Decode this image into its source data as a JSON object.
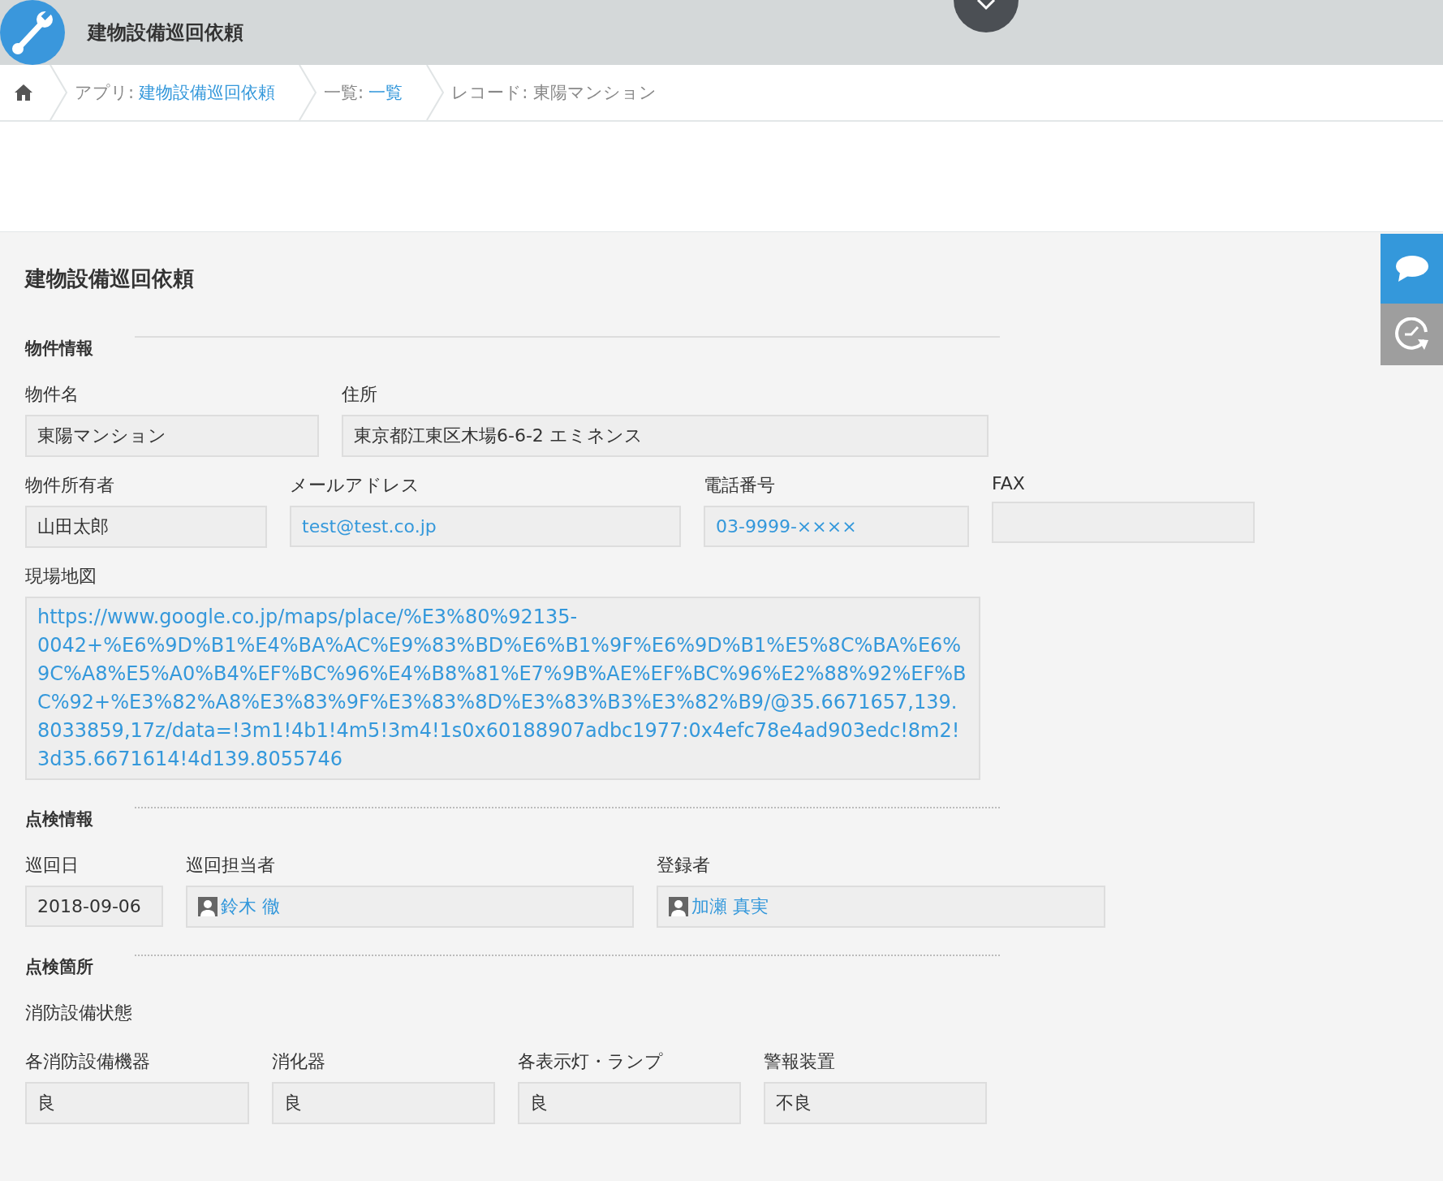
{
  "header": {
    "title": "建物設備巡回依頼"
  },
  "breadcrumb": [
    {
      "kind": "home"
    },
    {
      "kind": "link",
      "prefix": "アプリ:",
      "text": "建物設備巡回依頼"
    },
    {
      "kind": "link",
      "prefix": "一覧:",
      "text": "一覧"
    },
    {
      "kind": "text",
      "text": "レコード: 東陽マンション"
    }
  ],
  "record": {
    "title": "建物設備巡回依頼",
    "sections": [
      {
        "title": "物件情報",
        "kind": "solid",
        "rows": [
          {
            "kind": "fields",
            "fields": [
              {
                "label": "物件名",
                "kind": "text",
                "value": "東陽マンション"
              },
              {
                "label": "住所",
                "kind": "text",
                "value": "東京都江東区木場6-6-2 エミネンス"
              }
            ]
          },
          {
            "kind": "fields",
            "fields": [
              {
                "label": "物件所有者",
                "kind": "text",
                "value": "山田太郎"
              },
              {
                "label": "メールアドレス",
                "kind": "link",
                "value": "test@test.co.jp"
              },
              {
                "label": "電話番号",
                "kind": "link",
                "value": "03-9999-××××"
              },
              {
                "label": "FAX",
                "kind": "text"
              }
            ]
          },
          {
            "kind": "fields",
            "fields": [
              {
                "label": "現場地図",
                "kind": "url",
                "value": "https://www.google.co.jp/maps/place/%E3%80%92135-0042+%E6%9D%B1%E4%BA%AC%E9%83%BD%E6%B1%9F%E6%9D%B1%E5%8C%BA%E6%9C%A8%E5%A0%B4%EF%BC%96%E4%B8%81%E7%9B%AE%EF%BC%96%E2%88%92%EF%BC%92+%E3%82%A8%E3%83%9F%E3%83%8D%E3%83%B3%E3%82%B9/@35.6671657,139.8033859,17z/data=!3m1!4b1!4m5!3m4!1s0x60188907adbc1977:0x4efc78e4ad903edc!8m2!3d35.6671614!4d139.8055746"
              }
            ]
          }
        ]
      },
      {
        "title": "点検情報",
        "kind": "dotted",
        "rows": [
          {
            "kind": "fields",
            "fields": [
              {
                "label": "巡回日",
                "kind": "text",
                "value": "2018-09-06"
              },
              {
                "label": "巡回担当者",
                "kind": "user",
                "value": "鈴木 徹"
              },
              {
                "label": "登録者",
                "kind": "user",
                "value": "加瀬 真実"
              }
            ]
          }
        ]
      },
      {
        "title": "点検箇所",
        "kind": "dotted",
        "rows": [
          {
            "kind": "caption",
            "text": "消防設備状態"
          },
          {
            "kind": "fields",
            "fields": [
              {
                "label": "各消防設備機器",
                "kind": "text",
                "value": "良"
              },
              {
                "label": "消化器",
                "kind": "text",
                "value": "良"
              },
              {
                "label": "各表示灯・ランプ",
                "kind": "text",
                "value": "良"
              },
              {
                "label": "警報装置",
                "kind": "text",
                "value": "不良"
              }
            ]
          }
        ]
      }
    ]
  }
}
